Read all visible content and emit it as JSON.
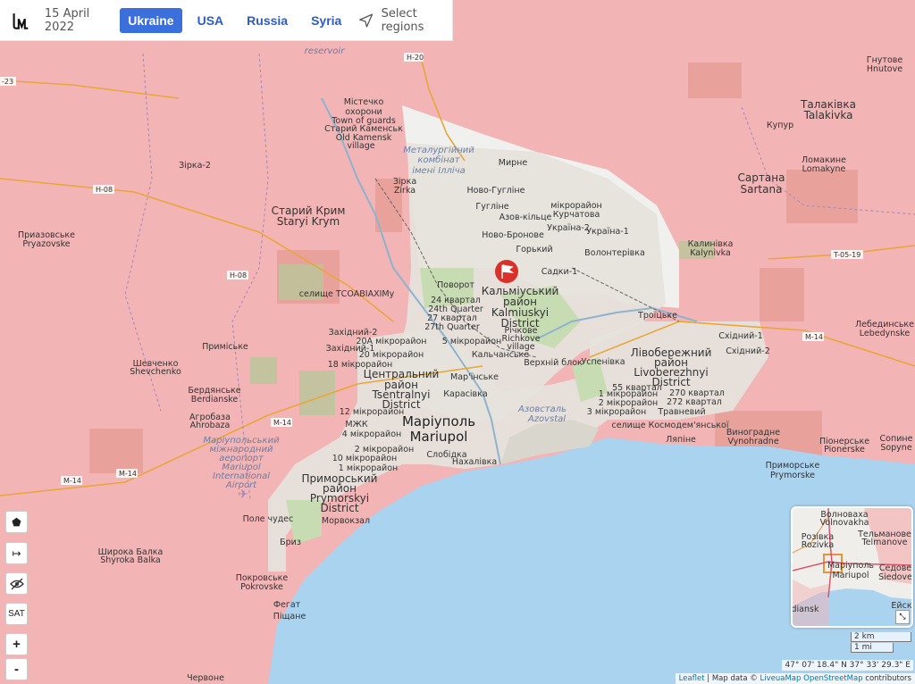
{
  "header": {
    "date": "15 April 2022",
    "nav": [
      "Ukraine",
      "USA",
      "Russia",
      "Syria"
    ],
    "active_nav": "Ukraine",
    "select_regions": "Select regions"
  },
  "colors": {
    "occupied": "#f2b4b4",
    "city_gray": "#e6e3dc",
    "sea": "#aad3f0",
    "accent": "#3b6fdc",
    "marker": "#d9302a"
  },
  "labels": {
    "mistechko": "Містечко",
    "okhorony": "охорони",
    "town_of_guards": "Town of guards",
    "staryi_kamensk": "Старий Каменськ",
    "old_kamensk": "Old Kamensk",
    "village": "village",
    "met_kombinat_1": "Металургійний",
    "met_kombinat_2": "комбінат",
    "met_kombinat_3": "імені Ілліча",
    "zirka2": "Зірка-2",
    "zirka": "Зірка",
    "zirka_en": "Zirka",
    "staryi_krym": "Старий Крим",
    "staryi_krym_en": "Staryi Krym",
    "pryazovske": "Приазовське",
    "pryazovske_en": "Pryazovske",
    "selyshche_tsoav": "селище ТСОАВІАХІМу",
    "myrne": "Мирне",
    "novo_huhlyne": "Ново-Гугліне",
    "huhline": "Гугліне",
    "azov_kilts": "Азов-кільце",
    "novo_bronove": "Ново-Бронове",
    "mkr_kurchatova_1": "мікрорайон",
    "mkr_kurchatova_2": "Курчатова",
    "ukraina2": "Україна-2",
    "ukraina1": "Україна-1",
    "horkyi": "Горький",
    "volontеrivka": "Волонтерівка",
    "sadky1": "Садки-1",
    "povorot": "Поворот",
    "kalm_1": "Кальміуський",
    "kalm_2": "район",
    "kalm_3": "Kalmiuskyi",
    "kalm_4": "District",
    "q24": "24 квартал",
    "q24_en": "24th Quarter",
    "q27": "27 квартал",
    "q27_en": "27th Quarter",
    "richkove": "Річкове",
    "richkove_en": "Richkove",
    "village2": "village",
    "zakhidnyi2": "Західний-2",
    "mkr20a": "20А мікрорайон",
    "zakhidnyi1": "Західний-1",
    "mkr20": "20 мікрорайон",
    "mkr18": "18 мікрорайон",
    "mkr5": "5 мікрорайон",
    "kalchanske": "Кальчанське",
    "verkhnii_blok": "Верхній блок",
    "uspenivka": "Успенівка",
    "marinske": "Мар'їнське",
    "tsentr_1": "Центральний",
    "tsentr_2": "район",
    "tsentr_3": "Tsentralnyi",
    "tsentr_4": "District",
    "karasivka": "Карасівка",
    "mkr12": "12 мікрорайон",
    "mzhk": "МЖК",
    "mkr4": "4 мікрорайон",
    "mariupol": "Маріуполь",
    "mariupol_en": "Mariupol",
    "azovstal": "Азовсталь",
    "azovstal_en": "Azovstal",
    "slobidka": "Слобідка",
    "nakhalivka": "Нахалівка",
    "mkr2": "2 мікрорайон",
    "mkr10": "10 мікрорайон",
    "mkr1": "1 мікрорайон",
    "prym_1": "Приморський",
    "prym_2": "район",
    "prym_3": "Prymorskyi",
    "prym_4": "District",
    "morvokzal": "Морвокзал",
    "pole_chudes": "Поле чудес",
    "bryz": "Бриз",
    "prymiske": "Приміське",
    "shevchenko": "Шевченко",
    "shevchenko_en": "Shevchenko",
    "berdianske": "Бердянське",
    "berdianske_en": "Berdianske",
    "ahrobaza": "Агробаза",
    "ahrobaza_en": "Ahrobaza",
    "airport_1": "Маріупольський",
    "airport_2": "міжнародний",
    "airport_3": "аеропорт",
    "airport_4": "Mariupol",
    "airport_5": "International",
    "airport_6": "Airport",
    "shyroka_balka": "Широка Балка",
    "shyroka_balka_en": "Shyroka Balka",
    "pokrovske": "Покровське",
    "pokrovske_en": "Pokrovske",
    "fehat": "Фегат",
    "pishane": "Піщане",
    "chervone": "Червоне",
    "troitske": "Троїцьке",
    "livob_1": "Лівобережний",
    "livob_2": "район",
    "livob_3": "Livoberezhnyi",
    "livob_4": "District",
    "skhidnyi1": "Східний-1",
    "skhidnyi2": "Східний-2",
    "q55": "55 квартал",
    "mkr1b": "1 мікрорайон",
    "mkr2b": "2 мікрорайон",
    "mkr3": "3 мікрорайон",
    "q270": "270 квартал",
    "q272": "272 квартал",
    "travnevyi": "Травневий",
    "selyshche_kosm": "селище Космодем'янської",
    "liapine": "Ляпіне",
    "vynohradne": "Виноградне",
    "vynohradne_en": "Vynohradne",
    "pionerske": "Піонерське",
    "pionerske_en": "Pionerske",
    "sopyne": "Сопине",
    "sopyne_en": "Sopyne",
    "prymorske": "Приморське",
    "prymorske_en": "Prymorske",
    "talakivka": "Талаківка",
    "talakivka_en": "Talakivka",
    "kupur": "Купур",
    "lomakyne": "Ломакине",
    "lomakyne_en": "Lomakyne",
    "sartana": "Сартана",
    "sartana_en": "Sartana",
    "kalynivka": "Калинівка",
    "kalynivka_en": "Kalynivka",
    "lebedynske": "Лебединське",
    "lebedynske_en": "Lebedynske",
    "hnutove": "Гнутове",
    "hnutove_en": "Hnutove",
    "reservoir": "reservoir",
    "h20": "H-20",
    "h08": "H-08",
    "h08b": "H-08",
    "m14": "M-14",
    "m14b": "M-14",
    "m14c": "M-14",
    "m14d": "M-14",
    "t0519": "T-05-19",
    "r23": "-23"
  },
  "minimap": {
    "volnovakha": "Волноваха",
    "volnovakha_en": "Volnovakha",
    "telmanove": "Тельманове",
    "telmanove_en": "Telmanove",
    "rozivka": "Розівка",
    "rozivka_en": "Rozivka",
    "mariupol": "Маріуполь",
    "mariupol_en": "Mariupol",
    "siedove": "Седове",
    "siedove_en": "Siedove",
    "yeisk": "Ейск",
    "dyansk": "diansk"
  },
  "controls": {
    "sat": "SAT",
    "zoom_in": "+",
    "zoom_out": "-"
  },
  "scale": {
    "km": "2 km",
    "mi": "1 mi"
  },
  "coords": "47° 07' 18.4\" N 37° 33' 29.3\" E",
  "attribution": {
    "leaflet": "Leaflet",
    "sep": " | Map data © ",
    "liveuamap": "LiveuaMap",
    "osm": "OpenStreetMap",
    "contributors": " contributors"
  }
}
